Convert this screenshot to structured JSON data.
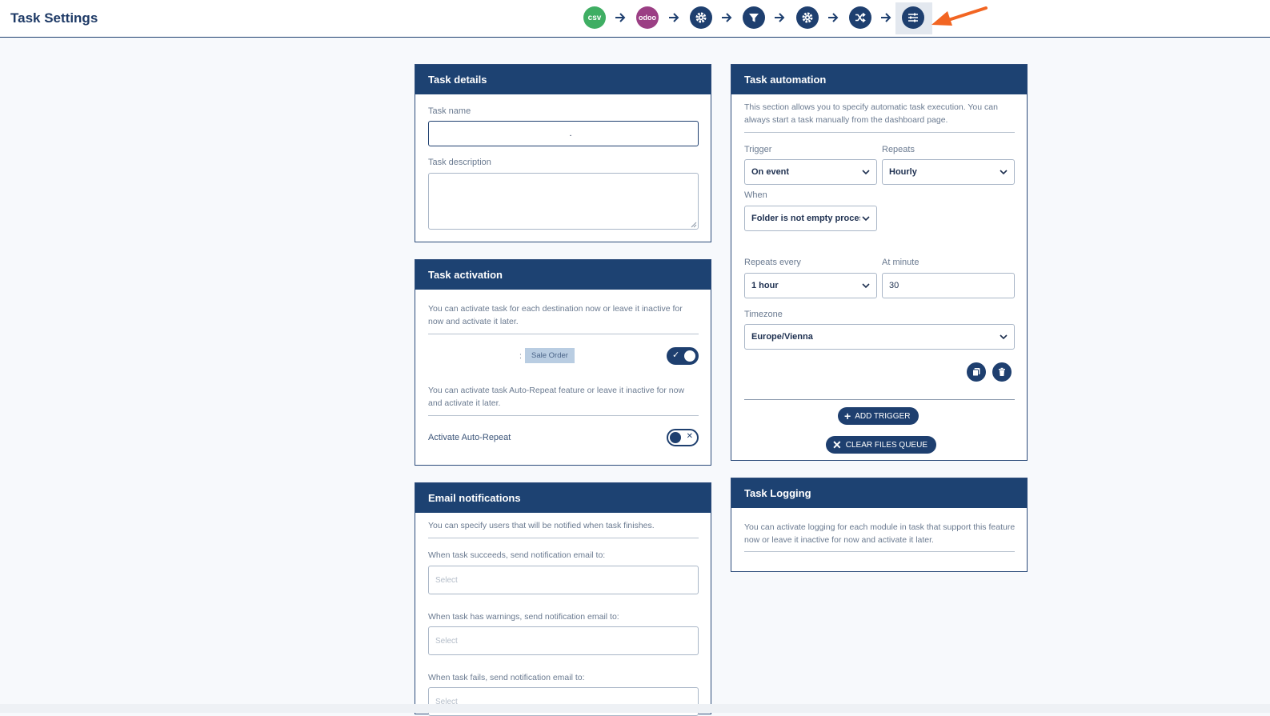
{
  "page_title": "Task Settings",
  "steps": [
    {
      "name": "csv-step",
      "label": "csv",
      "icon": "csv-badge"
    },
    {
      "name": "odoo-step",
      "label": "odoo",
      "icon": "odoo-badge"
    },
    {
      "name": "settings-step-1",
      "label": "",
      "icon": "gear-icon"
    },
    {
      "name": "filter-step",
      "label": "",
      "icon": "filter-icon"
    },
    {
      "name": "settings-step-2",
      "label": "",
      "icon": "gear-icon"
    },
    {
      "name": "shuffle-step",
      "label": "",
      "icon": "shuffle-icon"
    },
    {
      "name": "task-settings-step",
      "label": "",
      "icon": "sliders-icon"
    }
  ],
  "task_details": {
    "title": "Task details",
    "name_label": "Task name",
    "name_value": ".",
    "description_label": "Task description",
    "description_value": ""
  },
  "task_activation": {
    "title": "Task activation",
    "intro": "You can activate task for each destination now or leave it inactive for now and activate it later.",
    "destination_prefix": ":",
    "destination_tag": "Sale Order",
    "destination_active": true,
    "auto_repeat_intro": "You can activate task Auto-Repeat feature or leave it inactive for now and activate it later.",
    "auto_repeat_label": "Activate Auto-Repeat",
    "auto_repeat_active": false
  },
  "email_notifications": {
    "title": "Email notifications",
    "intro": "You can specify users that will be notified when task finishes.",
    "success_label": "When task succeeds, send notification email to:",
    "warnings_label": "When task has warnings, send notification email to:",
    "fails_label": "When task fails, send notification email to:",
    "select_placeholder": "Select"
  },
  "task_automation": {
    "title": "Task automation",
    "intro": "This section allows you to specify automatic task execution. You can always start a task manually from the dashboard page.",
    "trigger_label": "Trigger",
    "trigger_value": "On event",
    "repeats_label": "Repeats",
    "repeats_value": "Hourly",
    "when_label": "When",
    "when_value": "Folder is not empty process all files",
    "repeats_every_label": "Repeats every",
    "repeats_every_value": "1 hour",
    "at_minute_label": "At minute",
    "at_minute_value": "30",
    "timezone_label": "Timezone",
    "timezone_value": "Europe/Vienna",
    "add_trigger_label": "ADD TRIGGER",
    "clear_queue_label": "CLEAR FILES QUEUE"
  },
  "task_logging": {
    "title": "Task Logging",
    "intro": "You can activate logging for each module in task that support this feature now or leave it inactive for now and activate it later."
  },
  "colors": {
    "primary": "#1e3f6f",
    "csv": "#3fae63",
    "odoo": "#9b3f84",
    "annotation_arrow": "#f26522"
  }
}
